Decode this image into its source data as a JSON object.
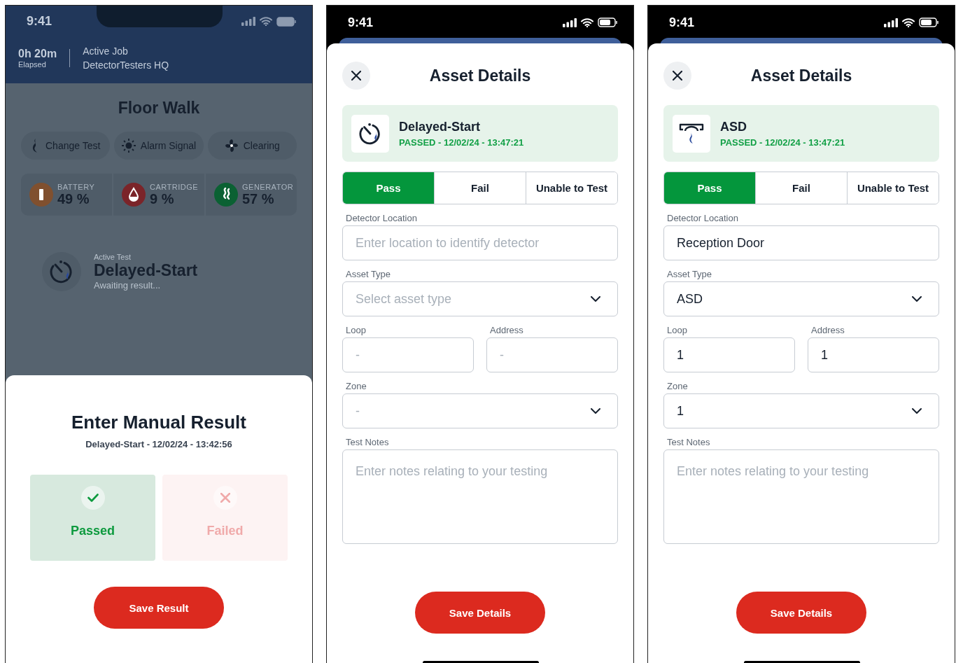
{
  "screens": [
    {
      "kind": "floor_walk",
      "status_time": "9:41",
      "elapsed": "0h 20m",
      "elapsed_label": "Elapsed",
      "job_label": "Active Job",
      "job_name": "DetectorTesters HQ",
      "title": "Floor Walk",
      "actions": [
        {
          "kind": "flame",
          "label": "Change Test"
        },
        {
          "kind": "sun",
          "label": "Alarm Signal"
        },
        {
          "kind": "fan",
          "label": "Clearing"
        }
      ],
      "gauges": [
        {
          "kind": "battery",
          "label": "BATTERY",
          "value": "49 %",
          "color": "#80502f"
        },
        {
          "kind": "drop",
          "label": "CARTRIDGE",
          "value": "9 %",
          "color": "#7b2429"
        },
        {
          "kind": "generator",
          "label": "GENERATOR",
          "value": "57 %",
          "color": "#0b6133"
        }
      ],
      "active_test": {
        "label": "Active Test",
        "name": "Delayed-Start",
        "status": "Awaiting result..."
      },
      "sheet": {
        "title": "Enter Manual Result",
        "subtitle": "Delayed-Start - 12/02/24 - 13:42:56",
        "options": [
          {
            "kind": "pass",
            "label": "Passed",
            "selected": true
          },
          {
            "kind": "fail",
            "label": "Failed",
            "selected": false
          }
        ],
        "button": "Save Result"
      }
    },
    {
      "kind": "asset_details",
      "status_time": "9:41",
      "title": "Asset Details",
      "asset": {
        "kind": "timer",
        "name": "Delayed-Start",
        "status": "PASSED - 12/02/24 - 13:47:21"
      },
      "segments": [
        {
          "label": "Pass",
          "selected": true
        },
        {
          "label": "Fail",
          "selected": false
        },
        {
          "label": "Unable to Test",
          "selected": false
        }
      ],
      "rows": [
        {
          "fields": [
            {
              "kind": "text",
              "label": "Detector Location",
              "placeholder": "Enter location to identify detector"
            }
          ]
        },
        {
          "fields": [
            {
              "kind": "select",
              "label": "Asset Type",
              "placeholder": "Select asset type"
            }
          ]
        },
        {
          "fields": [
            {
              "kind": "text",
              "label": "Loop",
              "placeholder": "-"
            },
            {
              "kind": "text",
              "label": "Address",
              "placeholder": "-"
            }
          ]
        },
        {
          "fields": [
            {
              "kind": "select",
              "label": "Zone",
              "placeholder": "-"
            }
          ]
        },
        {
          "fields": [
            {
              "kind": "textarea",
              "label": "Test Notes",
              "placeholder": "Enter notes relating to your testing"
            }
          ]
        }
      ],
      "button": "Save Details"
    },
    {
      "kind": "asset_details",
      "status_time": "9:41",
      "title": "Asset Details",
      "asset": {
        "kind": "asd",
        "name": "ASD",
        "status": "PASSED - 12/02/24 - 13:47:21"
      },
      "segments": [
        {
          "label": "Pass",
          "selected": true
        },
        {
          "label": "Fail",
          "selected": false
        },
        {
          "label": "Unable to Test",
          "selected": false
        }
      ],
      "rows": [
        {
          "fields": [
            {
              "kind": "text",
              "label": "Detector Location",
              "value": "Reception Door"
            }
          ]
        },
        {
          "fields": [
            {
              "kind": "select",
              "label": "Asset Type",
              "value": "ASD"
            }
          ]
        },
        {
          "fields": [
            {
              "kind": "text",
              "label": "Loop",
              "value": "1"
            },
            {
              "kind": "text",
              "label": "Address",
              "value": "1"
            }
          ]
        },
        {
          "fields": [
            {
              "kind": "select",
              "label": "Zone",
              "value": "1"
            }
          ]
        },
        {
          "fields": [
            {
              "kind": "textarea",
              "label": "Test Notes",
              "placeholder": "Enter notes relating to your testing"
            }
          ]
        }
      ],
      "button": "Save Details"
    }
  ]
}
